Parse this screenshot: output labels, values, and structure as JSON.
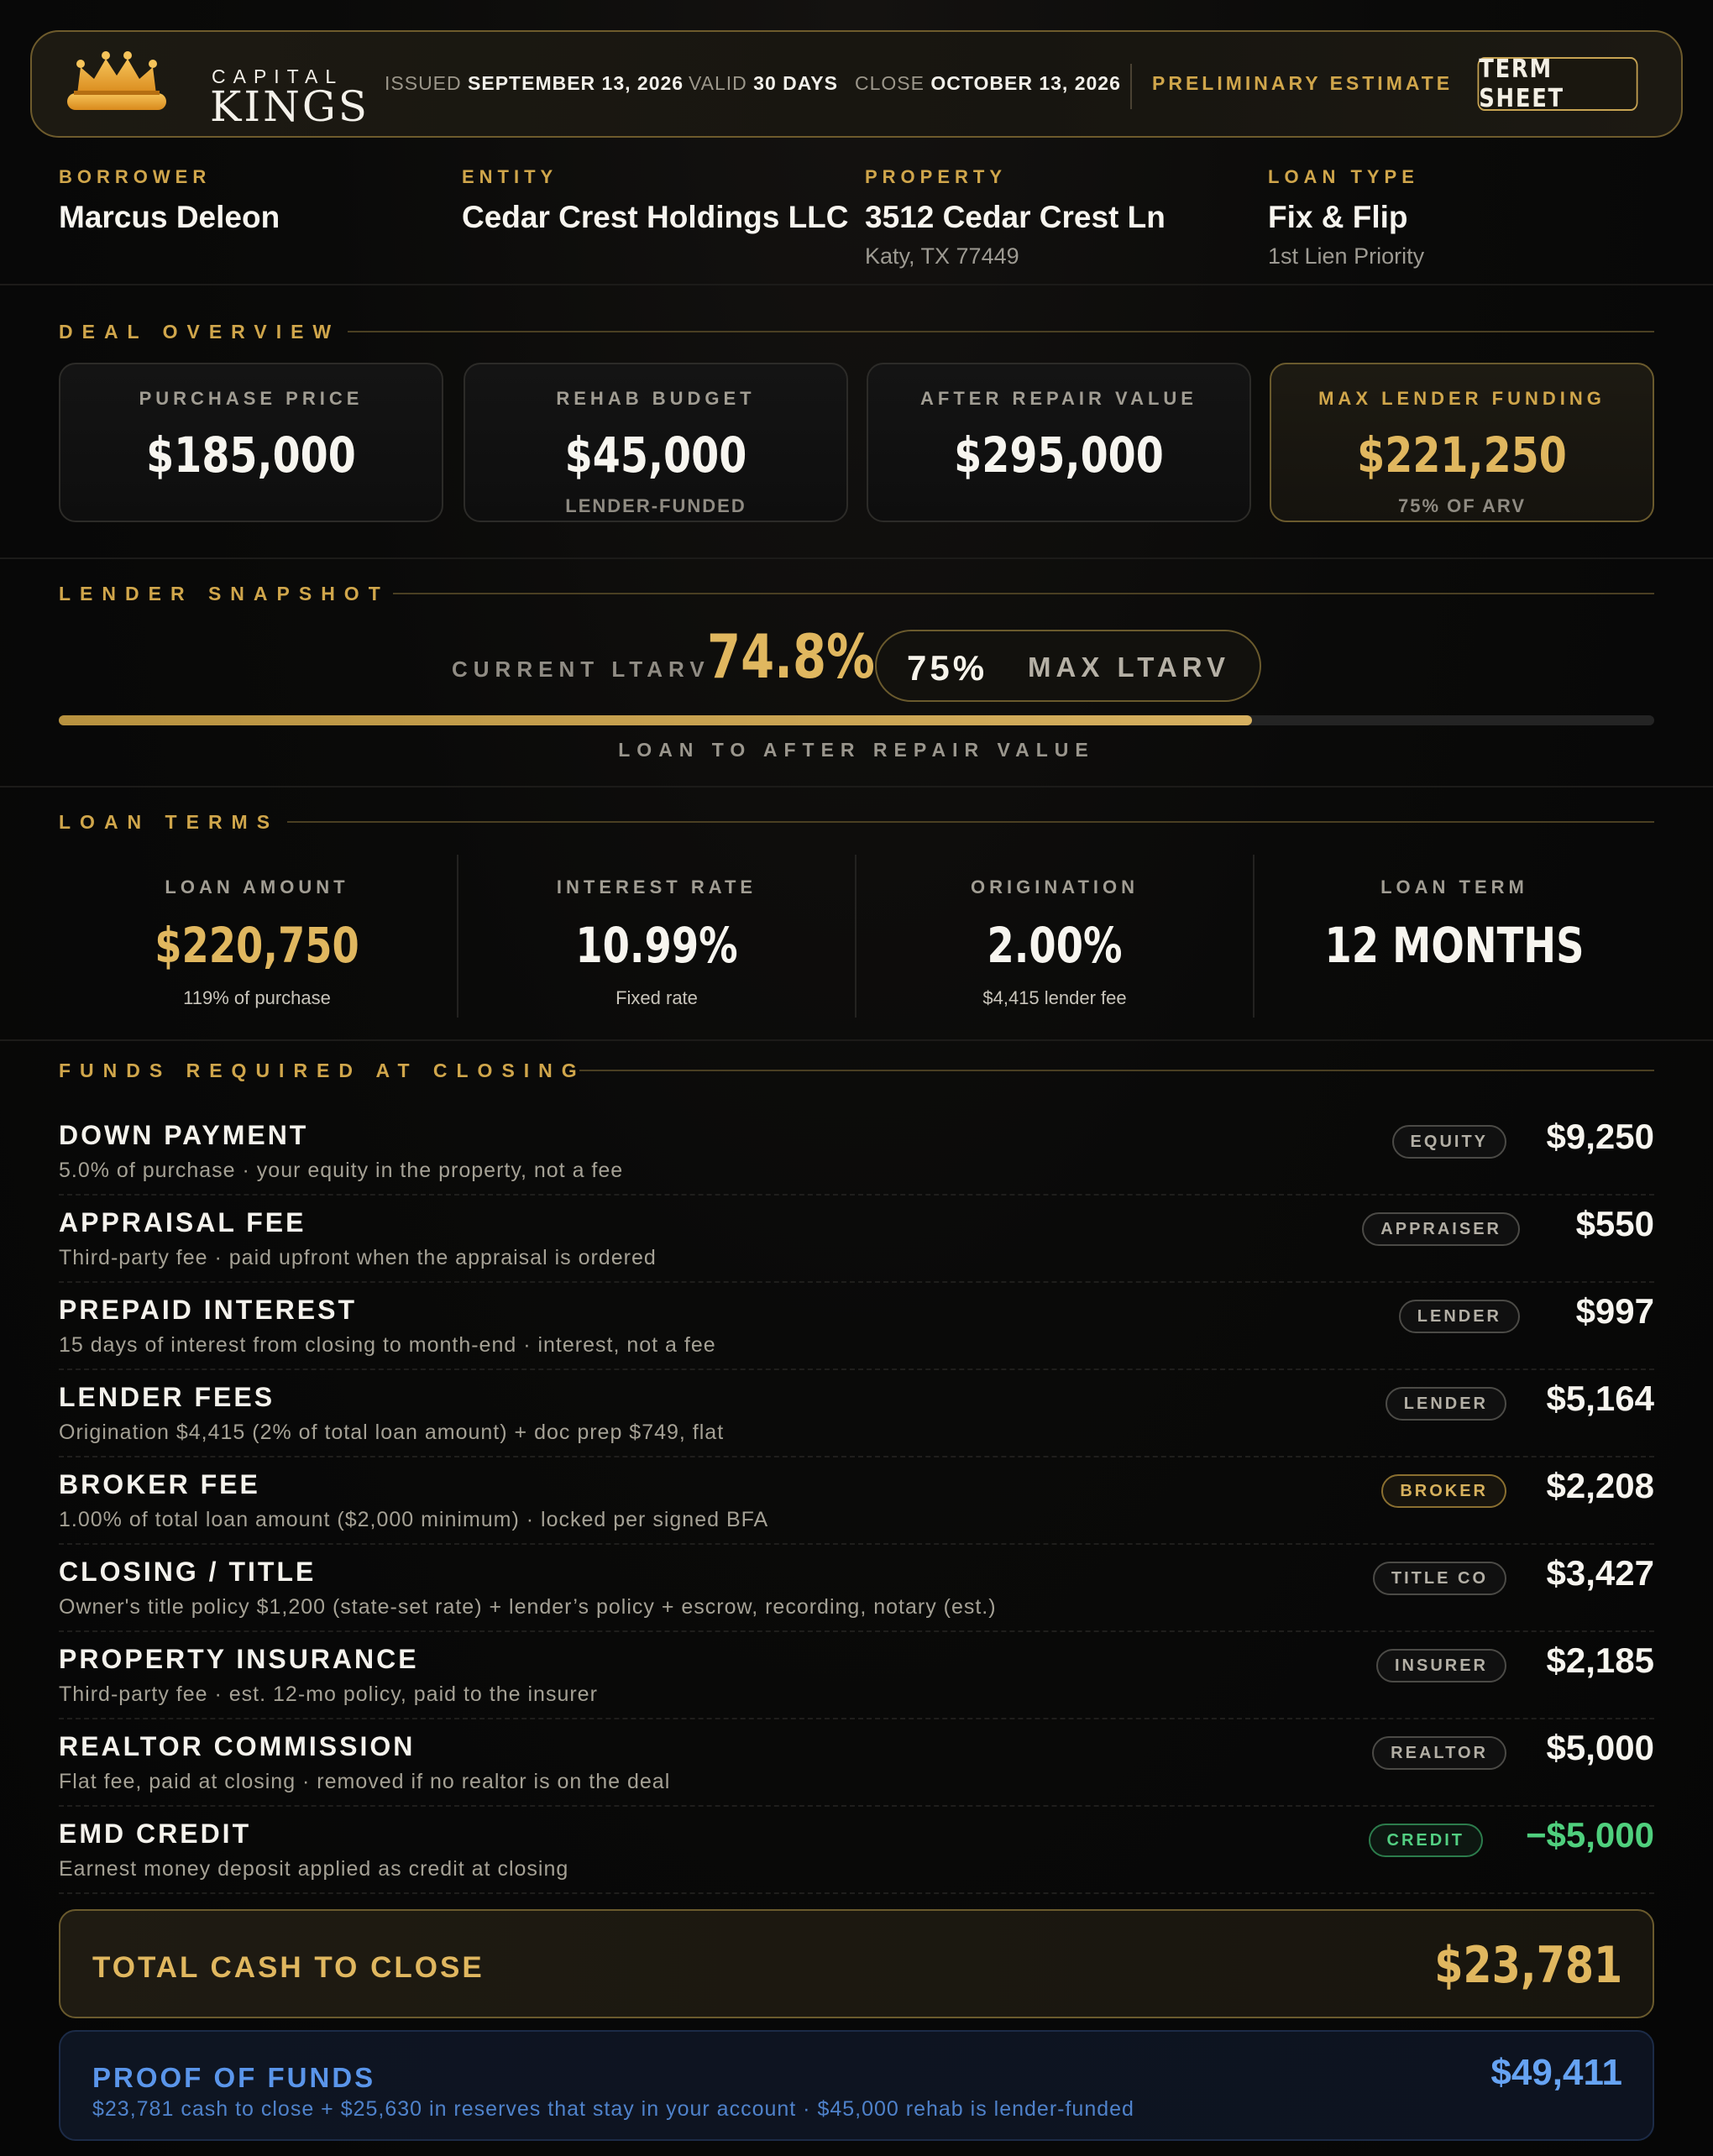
{
  "brand": {
    "top": "CAPITAL",
    "main": "KINGS"
  },
  "header": {
    "issued_label": "ISSUED",
    "issued_value": "SEPTEMBER 13, 2026",
    "valid_label": "VALID",
    "valid_value": "30 DAYS",
    "close_label": "CLOSE",
    "close_value": "OCTOBER 13, 2026",
    "status": "PRELIMINARY ESTIMATE",
    "button": "TERM SHEET"
  },
  "party": {
    "borrower": {
      "label": "BORROWER",
      "value": "Marcus Deleon"
    },
    "entity": {
      "label": "ENTITY",
      "value": "Cedar Crest Holdings LLC"
    },
    "property": {
      "label": "PROPERTY",
      "value": "3512 Cedar Crest Ln",
      "sub": "Katy, TX 77449"
    },
    "loan_type": {
      "label": "LOAN TYPE",
      "value": "Fix & Flip",
      "sub": "1st Lien Priority"
    }
  },
  "deal_overview": {
    "title": "DEAL OVERVIEW",
    "cards": [
      {
        "label": "PURCHASE PRICE",
        "value": "$185,000",
        "sub": ""
      },
      {
        "label": "REHAB BUDGET",
        "value": "$45,000",
        "sub": "LENDER-FUNDED"
      },
      {
        "label": "AFTER REPAIR VALUE",
        "value": "$295,000",
        "sub": ""
      },
      {
        "label": "MAX LENDER FUNDING",
        "value": "$221,250",
        "sub": "75% OF ARV"
      }
    ]
  },
  "snapshot": {
    "title": "LENDER SNAPSHOT",
    "current_label": "CURRENT LTARV",
    "current_value": "74.8%",
    "max_value": "75%",
    "max_label": "MAX LTARV",
    "progress_fraction": 0.748,
    "bar_caption": "LOAN TO AFTER REPAIR VALUE"
  },
  "loan_terms": {
    "title": "LOAN TERMS",
    "items": [
      {
        "label": "LOAN AMOUNT",
        "value": "$220,750",
        "sub": "119% of purchase"
      },
      {
        "label": "INTEREST RATE",
        "value": "10.99%",
        "sub": "Fixed rate"
      },
      {
        "label": "ORIGINATION",
        "value": "2.00%",
        "sub": "$4,415 lender fee"
      },
      {
        "label": "LOAN TERM",
        "value": "12 MONTHS",
        "sub": ""
      }
    ]
  },
  "funds": {
    "title": "FUNDS REQUIRED AT CLOSING",
    "rows": [
      {
        "name": "DOWN PAYMENT",
        "desc": "5.0% of purchase · your equity in the property, not a fee",
        "badge": "EQUITY",
        "amount": "$9,250"
      },
      {
        "name": "APPRAISAL FEE",
        "desc": "Third-party fee · paid upfront when the appraisal is ordered",
        "badge": "APPRAISER",
        "amount": "$550"
      },
      {
        "name": "PREPAID INTEREST",
        "desc": "15 days of interest from closing to month-end · interest, not a fee",
        "badge": "LENDER",
        "amount": "$997"
      },
      {
        "name": "LENDER FEES",
        "desc": "Origination $4,415 (2% of total loan amount) + doc prep $749, flat",
        "badge": "LENDER",
        "amount": "$5,164"
      },
      {
        "name": "BROKER FEE",
        "desc": "1.00% of total loan amount ($2,000 minimum) · locked per signed BFA",
        "badge": "BROKER",
        "amount": "$2,208"
      },
      {
        "name": "CLOSING / TITLE",
        "desc": "Owner's title policy $1,200 (state-set rate) + lender’s policy + escrow, recording, notary (est.)",
        "badge": "TITLE CO",
        "amount": "$3,427"
      },
      {
        "name": "PROPERTY INSURANCE",
        "desc": "Third-party fee · est. 12-mo policy, paid to the insurer",
        "badge": "INSURER",
        "amount": "$2,185"
      },
      {
        "name": "REALTOR COMMISSION",
        "desc": "Flat fee, paid at closing · removed if no realtor is on the deal",
        "badge": "REALTOR",
        "amount": "$5,000"
      },
      {
        "name": "EMD CREDIT",
        "desc": "Earnest money deposit applied as credit at closing",
        "badge": "CREDIT",
        "amount": "−$5,000"
      }
    ],
    "total_label": "TOTAL CASH TO CLOSE",
    "total_value": "$23,781"
  },
  "proof_of_funds": {
    "label": "PROOF OF FUNDS",
    "sub": "$23,781 cash to close + $25,630 in reserves that stay in your account · $45,000 rehab is lender-funded",
    "value": "$49,411"
  },
  "colors": {
    "gold": "#d0a64b",
    "gold_bright": "#e0b75f",
    "green": "#4fcf7d",
    "blue": "#5a95ea",
    "bg": "#070707"
  }
}
